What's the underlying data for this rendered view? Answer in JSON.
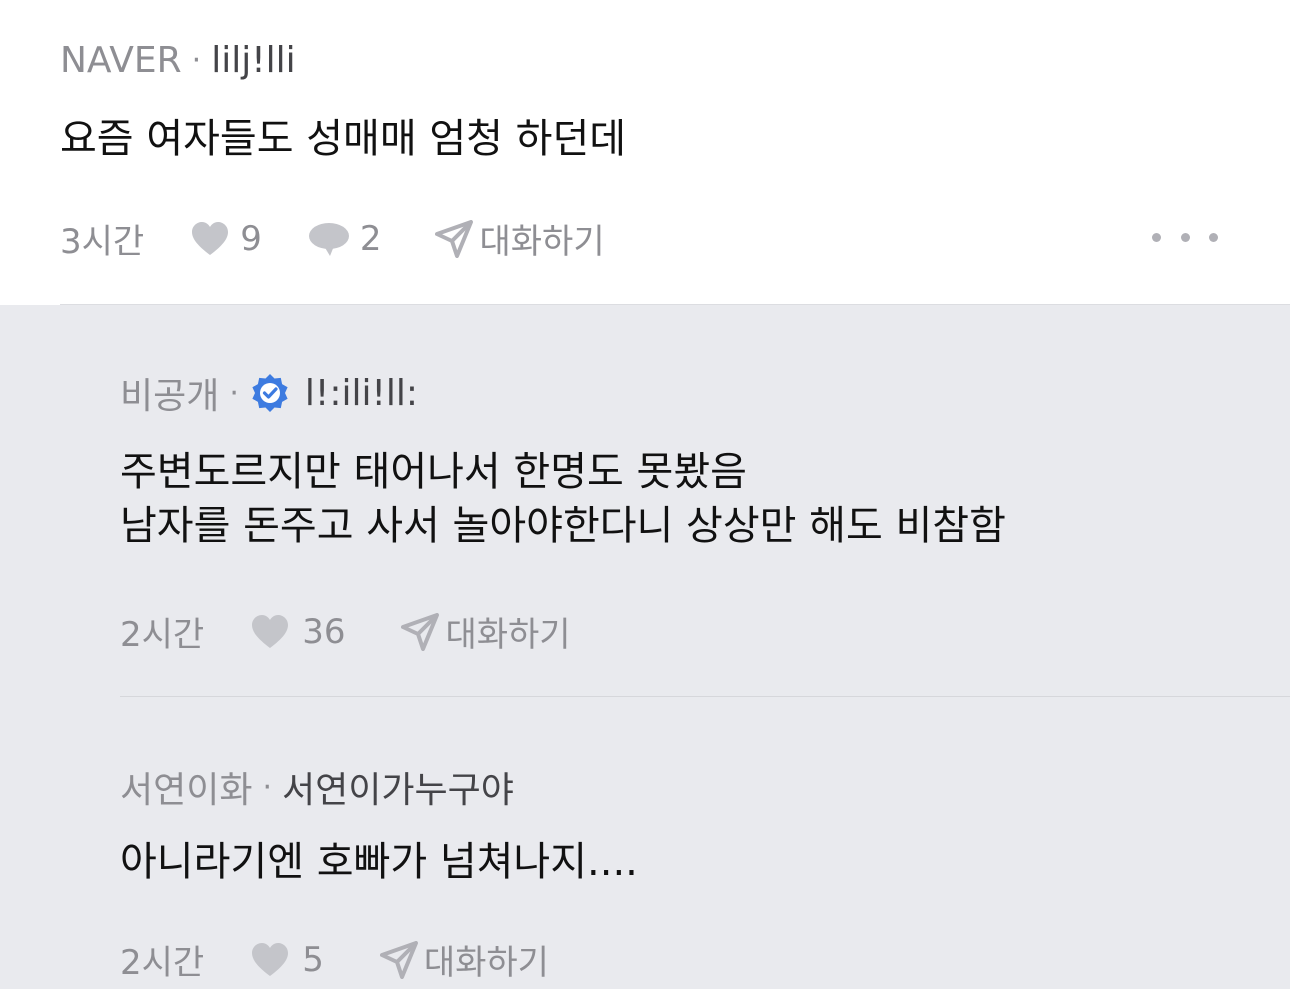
{
  "top_comment": {
    "source": "NAVER",
    "nickname": "lilj!lli",
    "text": "요즘 여자들도 성매매 엄청 하던데",
    "time": "3시간",
    "likes": "9",
    "replies": "2",
    "chat_label": "대화하기"
  },
  "replies": [
    {
      "source": "비공개",
      "nickname": "l!:ili!ll:",
      "verified": true,
      "lines": [
        "주변도르지만 태어나서 한명도 못봤음",
        "남자를 돈주고 사서 놀아야한다니 상상만 해도 비참함"
      ],
      "time": "2시간",
      "likes": "36",
      "chat_label": "대화하기"
    },
    {
      "source": "서연이화",
      "nickname": "서연이가누구야",
      "verified": false,
      "lines": [
        "아니라기엔 호빠가 넘쳐나지...."
      ],
      "time": "2시간",
      "likes": "5",
      "chat_label": "대화하기"
    }
  ],
  "colors": {
    "verified_badge": "#3d7be0",
    "reply_background": "#e9eaee",
    "meta_gray": "#8e8e93"
  },
  "icons": {
    "like": "heart-icon",
    "reply": "speech-bubble-icon",
    "chat": "paper-plane-icon",
    "more": "more-dots-icon",
    "verified": "verified-badge-icon"
  }
}
